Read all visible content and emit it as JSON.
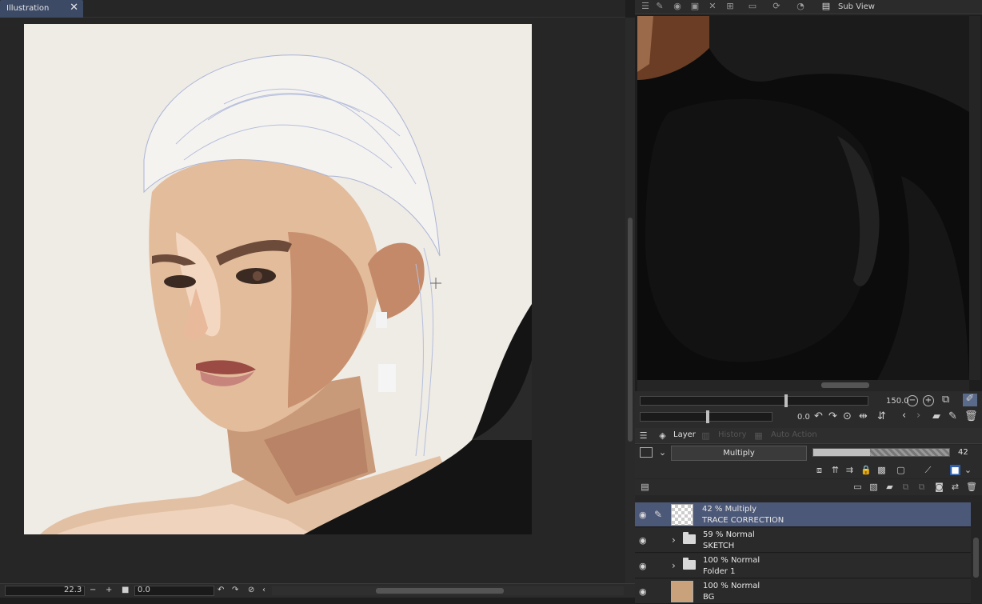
{
  "document_tab": {
    "title": "Illustration",
    "close": "✕"
  },
  "status_bar": {
    "zoom": "22.3",
    "zoom_minus": "−",
    "zoom_plus": "+",
    "rotation": "0.0"
  },
  "sub_view": {
    "title": "Sub View"
  },
  "navigator": {
    "zoom_value": "150.0",
    "rotate_value": "0.0"
  },
  "layer_panel": {
    "tabs": [
      "Layer",
      "History",
      "Auto Action"
    ],
    "blend_mode": "Multiply",
    "opacity": "42",
    "opacity_fraction": 0.42,
    "layers": [
      {
        "mode": "42 % Multiply",
        "name": "TRACE CORRECTION",
        "selected": true
      },
      {
        "mode": "59 % Normal",
        "name": "SKETCH"
      },
      {
        "mode": "100 % Normal",
        "name": "Folder 1"
      },
      {
        "mode": "100 % Normal",
        "name": "BG"
      }
    ]
  },
  "colors": {
    "selected_row": "#4c5878",
    "tab_active": "#3c4a66",
    "canvas_bg": "#efebe5"
  }
}
